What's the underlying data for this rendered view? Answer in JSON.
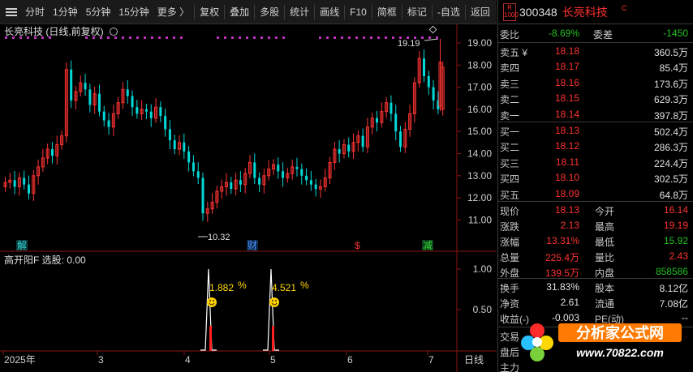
{
  "toolbar": {
    "items": [
      "分时",
      "1分钟",
      "5分钟",
      "15分钟",
      "更多 〉",
      "复权",
      "叠加",
      "多股",
      "统计",
      "画线",
      "F10",
      "简框",
      "标记",
      "-自选",
      "返回"
    ]
  },
  "chart": {
    "title": "长亮科技 (日线,前复权)",
    "price_axis": [
      "19.00",
      "18.00",
      "17.00",
      "16.00",
      "15.00",
      "14.00",
      "13.00",
      "12.00",
      "11.00"
    ],
    "high_label": "19.19",
    "low_label": "10.32",
    "event_markers": [
      "解",
      "财",
      "$",
      "减"
    ],
    "up_color": "#ff3333",
    "down_color": "#00d8d8"
  },
  "indicator": {
    "title": "高开阳F  选股: 0.00",
    "axis": [
      "1.00",
      "0.50"
    ],
    "signals": [
      {
        "pct": "1.882",
        "unit": "%"
      },
      {
        "pct": "4.521",
        "unit": "%"
      }
    ]
  },
  "time_axis": {
    "labels": [
      "2025年",
      "3",
      "4",
      "5",
      "6",
      "7"
    ],
    "period": "日线"
  },
  "quote": {
    "badge_top": "R",
    "badge_bottom": "1000",
    "code": "300348",
    "name": "长亮科技",
    "name_suffix": "C",
    "weibi_label": "委比",
    "weibi": "-8.69%",
    "weicha_label": "委差",
    "weicha": "-1450",
    "asks": [
      {
        "label": "卖五 ¥",
        "price": "18.18",
        "vol": "360.5万"
      },
      {
        "label": "卖四",
        "price": "18.17",
        "vol": "85.4万"
      },
      {
        "label": "卖三",
        "price": "18.16",
        "vol": "173.6万"
      },
      {
        "label": "卖二",
        "price": "18.15",
        "vol": "629.3万"
      },
      {
        "label": "卖一",
        "price": "18.14",
        "vol": "397.8万"
      }
    ],
    "bids": [
      {
        "label": "买一",
        "price": "18.13",
        "vol": "502.4万"
      },
      {
        "label": "买二",
        "price": "18.12",
        "vol": "286.3万"
      },
      {
        "label": "买三",
        "price": "18.11",
        "vol": "224.4万"
      },
      {
        "label": "买四",
        "price": "18.10",
        "vol": "302.5万"
      },
      {
        "label": "买五",
        "price": "18.09",
        "vol": "64.8万"
      }
    ],
    "stats": [
      {
        "l1": "现价",
        "v1": "18.13",
        "l2": "今开",
        "v2": "16.14"
      },
      {
        "l1": "涨跌",
        "v1": "2.13",
        "l2": "最高",
        "v2": "19.19"
      },
      {
        "l1": "涨幅",
        "v1": "13.31%",
        "l2": "最低",
        "v2": "15.92"
      },
      {
        "l1": "总量",
        "v1": "225.4万",
        "l2": "量比",
        "v2": "2.43"
      },
      {
        "l1": "外盘",
        "v1": "139.5万",
        "l2": "内盘",
        "v2": "858586"
      }
    ],
    "fund": [
      {
        "l1": "换手",
        "v1": "31.83%",
        "l2": "股本",
        "v2": "8.12亿"
      },
      {
        "l1": "净资",
        "v1": "2.61",
        "l2": "流通",
        "v2": "7.08亿"
      },
      {
        "l1": "收益(-)",
        "v1": "-0.003",
        "l2": "PE(动)",
        "v2": "--"
      }
    ],
    "extra": [
      "交易",
      "盘后",
      "主力"
    ]
  },
  "watermark": {
    "title": "分析家公式网",
    "url": "www.70822.com"
  }
}
